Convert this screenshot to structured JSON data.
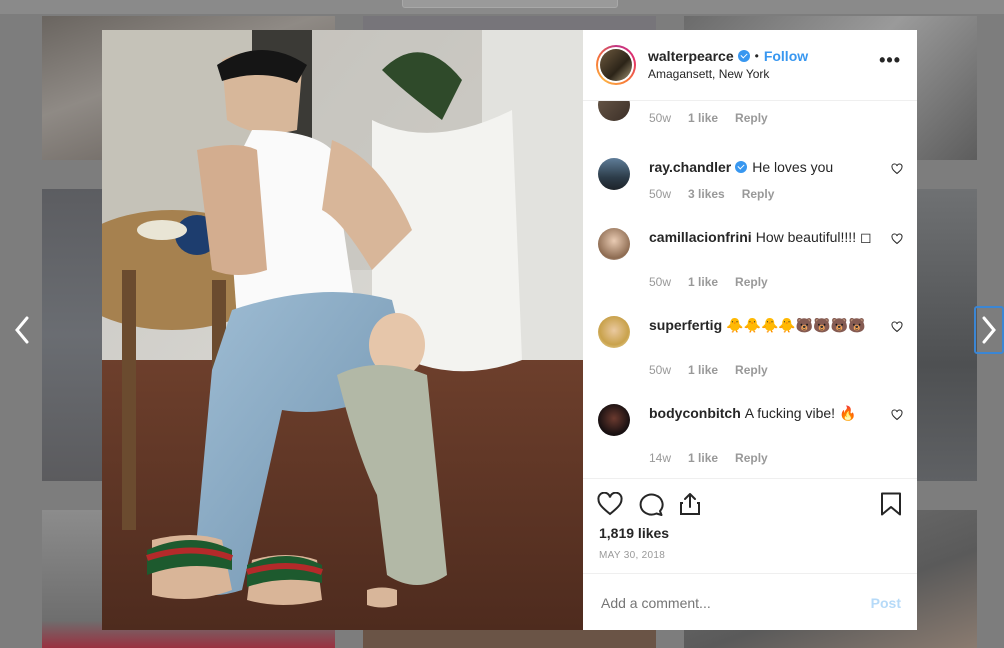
{
  "post": {
    "username": "walterpearce",
    "follow_label": "Follow",
    "separator": "•",
    "location": "Amagansett, New York",
    "more_label": "•••",
    "likes": "1,819 likes",
    "date": "MAY 30, 2018"
  },
  "comments": [
    {
      "user": "",
      "text": "",
      "age": "50w",
      "likes": "1 like",
      "reply": "Reply"
    },
    {
      "user": "ray.chandler",
      "verified": true,
      "text": "He loves you",
      "age": "50w",
      "likes": "3 likes",
      "reply": "Reply"
    },
    {
      "user": "camillacionfrini",
      "text": "How beautiful!!!! ◻",
      "age": "50w",
      "likes": "1 like",
      "reply": "Reply"
    },
    {
      "user": "superfertig",
      "text": "🐥🐥🐥🐥🐻🐻🐻🐻",
      "age": "50w",
      "likes": "1 like",
      "reply": "Reply"
    },
    {
      "user": "bodyconbitch",
      "text": "A fucking vibe! 🔥",
      "age": "14w",
      "likes": "1 like",
      "reply": "Reply"
    }
  ],
  "add_comment": {
    "placeholder": "Add a comment...",
    "post_label": "Post"
  },
  "colors": {
    "accent": "#3897f0",
    "post_disabled": "#b6daf8"
  },
  "icons": [
    "heart-icon",
    "comment-icon",
    "share-icon",
    "bookmark-icon",
    "chevron-left-icon",
    "chevron-right-icon",
    "verified-badge-icon"
  ]
}
